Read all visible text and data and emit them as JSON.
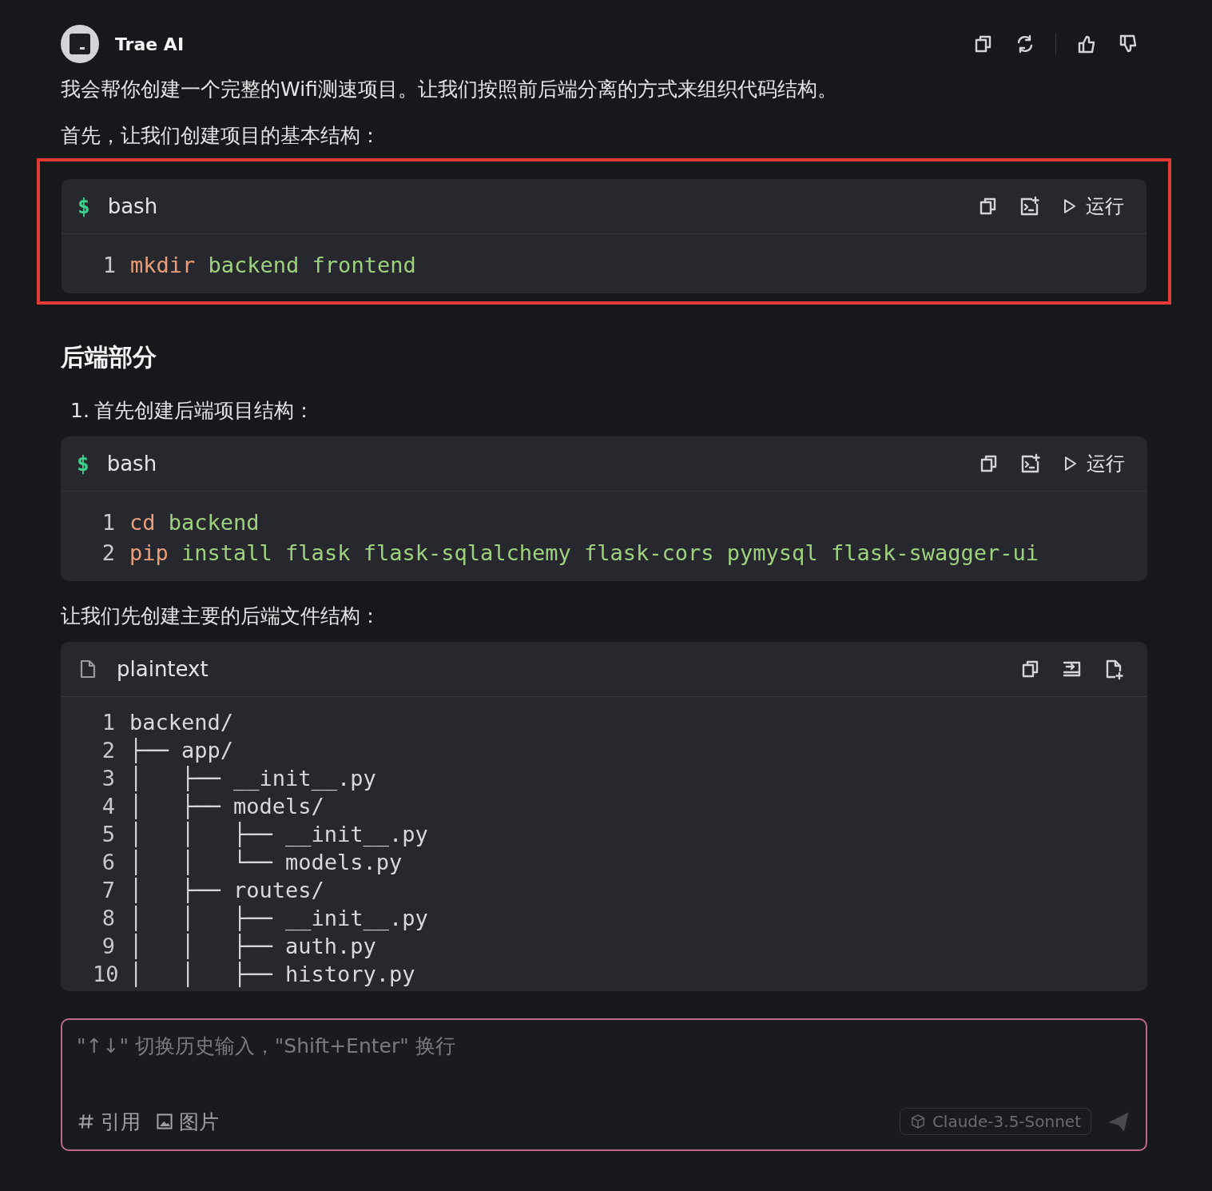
{
  "header": {
    "name": "Trae AI"
  },
  "message": [
    {
      "kind": "paragraph",
      "text": "我会帮你创建一个完整的Wifi测速项目。让我们按照前后端分离的方式来组织代码结构。"
    },
    {
      "kind": "paragraph",
      "text": "首先，让我们创建项目的基本结构："
    },
    {
      "kind": "code",
      "language": "bash",
      "prompt": "$",
      "highlighted": true,
      "actions": [
        {
          "kind": "copy"
        },
        {
          "kind": "insert"
        },
        {
          "kind": "run",
          "label": "运行"
        }
      ],
      "lines": [
        {
          "number": "1",
          "tokens": [
            {
              "text": "mkdir",
              "kind": "command"
            },
            {
              "text": "backend",
              "kind": "arg"
            },
            {
              "text": "frontend",
              "kind": "arg"
            }
          ]
        }
      ]
    },
    {
      "kind": "heading",
      "text": "后端部分"
    },
    {
      "kind": "list_item",
      "marker": "1.",
      "text": "首先创建后端项目结构："
    },
    {
      "kind": "code",
      "language": "bash",
      "prompt": "$",
      "highlighted": false,
      "actions": [
        {
          "kind": "copy"
        },
        {
          "kind": "insert"
        },
        {
          "kind": "run",
          "label": "运行"
        }
      ],
      "lines": [
        {
          "number": "1",
          "tokens": [
            {
              "text": "cd",
              "kind": "command"
            },
            {
              "text": "backend",
              "kind": "arg"
            }
          ]
        },
        {
          "number": "2",
          "tokens": [
            {
              "text": "pip",
              "kind": "command"
            },
            {
              "text": "install",
              "kind": "arg"
            },
            {
              "text": "flask",
              "kind": "arg"
            },
            {
              "text": "flask-sqlalchemy",
              "kind": "arg"
            },
            {
              "text": "flask-cors",
              "kind": "arg"
            },
            {
              "text": "pymysql",
              "kind": "arg"
            },
            {
              "text": "flask-swagger-ui",
              "kind": "arg"
            }
          ]
        }
      ]
    },
    {
      "kind": "paragraph",
      "text": "让我们先创建主要的后端文件结构："
    },
    {
      "kind": "code",
      "language": "plaintext",
      "highlighted": false,
      "actions": [
        {
          "kind": "copy"
        },
        {
          "kind": "apply"
        },
        {
          "kind": "new-file"
        }
      ],
      "lines": [
        {
          "number": "1",
          "tokens": [
            {
              "text": "backend/",
              "kind": "plain"
            }
          ]
        },
        {
          "number": "2",
          "tokens": [
            {
              "text": "├── app/",
              "kind": "plain"
            }
          ]
        },
        {
          "number": "3",
          "tokens": [
            {
              "text": "│   ├── __init__.py",
              "kind": "plain"
            }
          ]
        },
        {
          "number": "4",
          "tokens": [
            {
              "text": "│   ├── models/",
              "kind": "plain"
            }
          ]
        },
        {
          "number": "5",
          "tokens": [
            {
              "text": "│   │   ├── __init__.py",
              "kind": "plain"
            }
          ]
        },
        {
          "number": "6",
          "tokens": [
            {
              "text": "│   │   └── models.py",
              "kind": "plain"
            }
          ]
        },
        {
          "number": "7",
          "tokens": [
            {
              "text": "│   ├── routes/",
              "kind": "plain"
            }
          ]
        },
        {
          "number": "8",
          "tokens": [
            {
              "text": "│   │   ├── __init__.py",
              "kind": "plain"
            }
          ]
        },
        {
          "number": "9",
          "tokens": [
            {
              "text": "│   │   ├── auth.py",
              "kind": "plain"
            }
          ]
        },
        {
          "number": "10",
          "tokens": [
            {
              "text": "│   │   ├── history.py",
              "kind": "plain"
            }
          ]
        }
      ]
    }
  ],
  "input": {
    "placeholder": "\"↑↓\" 切换历史输入，\"Shift+Enter\" 换行",
    "tools": [
      {
        "kind": "hash",
        "label": "引用"
      },
      {
        "kind": "image",
        "label": "图片"
      }
    ],
    "model": "Claude-3.5-Sonnet"
  }
}
